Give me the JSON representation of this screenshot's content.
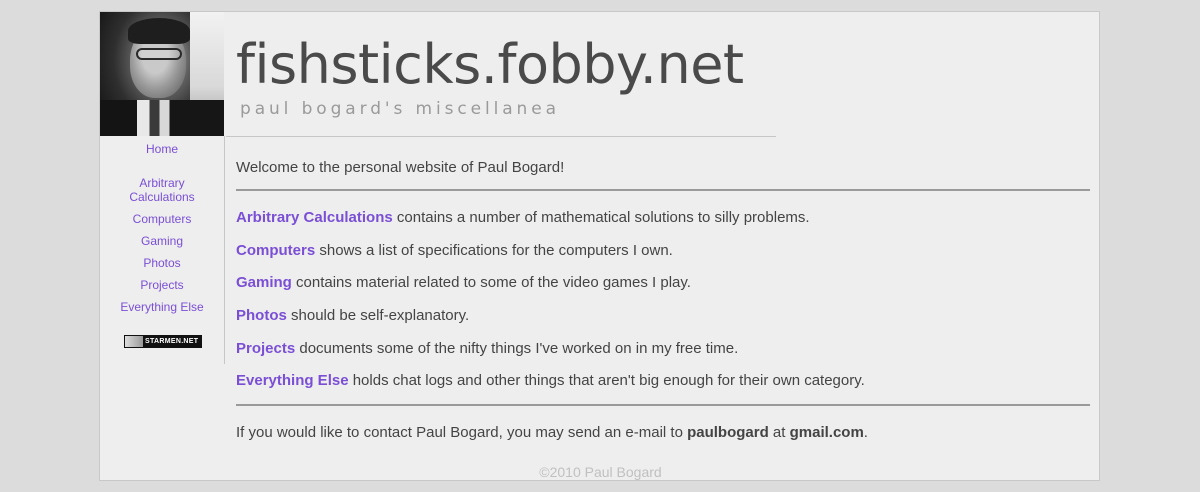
{
  "header": {
    "site_title": "fishsticks.fobby.net",
    "tagline": "paul bogard's miscellanea"
  },
  "sidebar": {
    "items": [
      {
        "label": "Home"
      },
      {
        "label": "Arbitrary Calculations"
      },
      {
        "label": "Computers"
      },
      {
        "label": "Gaming"
      },
      {
        "label": "Photos"
      },
      {
        "label": "Projects"
      },
      {
        "label": "Everything Else"
      }
    ],
    "badge_label": "STARMEN.NET"
  },
  "main": {
    "welcome": "Welcome to the personal website of Paul Bogard!",
    "sections": [
      {
        "link": "Arbitrary Calculations",
        "text": " contains a number of mathematical solutions to silly problems."
      },
      {
        "link": "Computers",
        "text": " shows a list of specifications for the computers I own."
      },
      {
        "link": "Gaming",
        "text": " contains material related to some of the video games I play."
      },
      {
        "link": "Photos",
        "text": " should be self-explanatory."
      },
      {
        "link": "Projects",
        "text": " documents some of the nifty things I've worked on in my free time."
      },
      {
        "link": "Everything Else",
        "text": " holds chat logs and other things that aren't big enough for their own category."
      }
    ],
    "contact": {
      "prefix": "If you would like to contact Paul Bogard, you may send an e-mail to ",
      "user": "paulbogard",
      "middle": " at ",
      "domain": "gmail.com",
      "suffix": "."
    }
  },
  "footer": {
    "copyright": "©2010 Paul Bogard"
  },
  "colors": {
    "link": "#7a4fd6",
    "background": "#dcdcdc",
    "page": "#eeeeee"
  }
}
